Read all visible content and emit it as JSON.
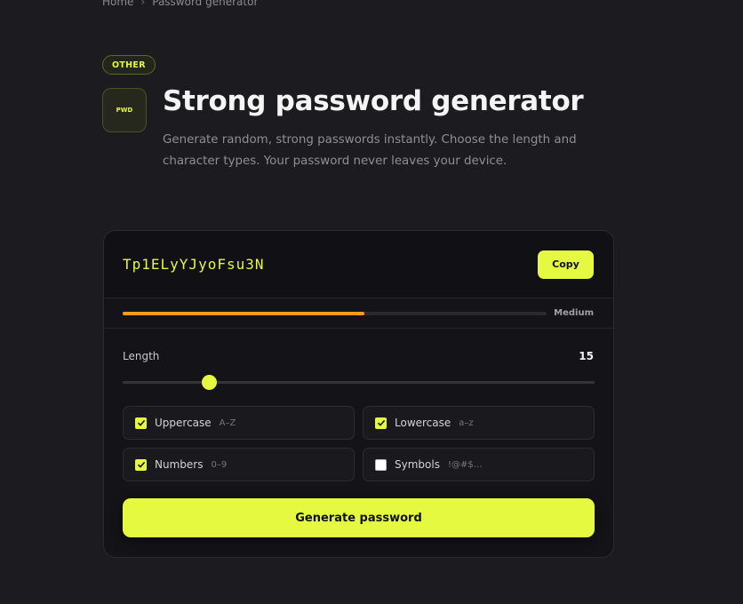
{
  "breadcrumb": {
    "home": "Home",
    "separator": "›",
    "current": "Password generator"
  },
  "badge": "OTHER",
  "app_icon_text": "PWD",
  "title": "Strong password generator",
  "subtitle": "Generate random, strong passwords instantly. Choose the length and character types. Your password never leaves your device.",
  "password": "Tp1ELyYJyoFsu3N",
  "copy_label": "Copy",
  "strength": {
    "label": "Medium",
    "fraction": 0.57,
    "color": "#ff9a1f"
  },
  "length": {
    "label": "Length",
    "value": "15",
    "min": 4,
    "max": 64
  },
  "options": [
    {
      "name": "Uppercase",
      "hint": "A–Z",
      "checked": true
    },
    {
      "name": "Lowercase",
      "hint": "a–z",
      "checked": true
    },
    {
      "name": "Numbers",
      "hint": "0–9",
      "checked": true
    },
    {
      "name": "Symbols",
      "hint": "!@#$…",
      "checked": false
    }
  ],
  "generate_label": "Generate password",
  "colors": {
    "accent": "#e4f93f",
    "background": "#1c1c20",
    "card": "#141418",
    "strength": "#ff9a1f"
  }
}
